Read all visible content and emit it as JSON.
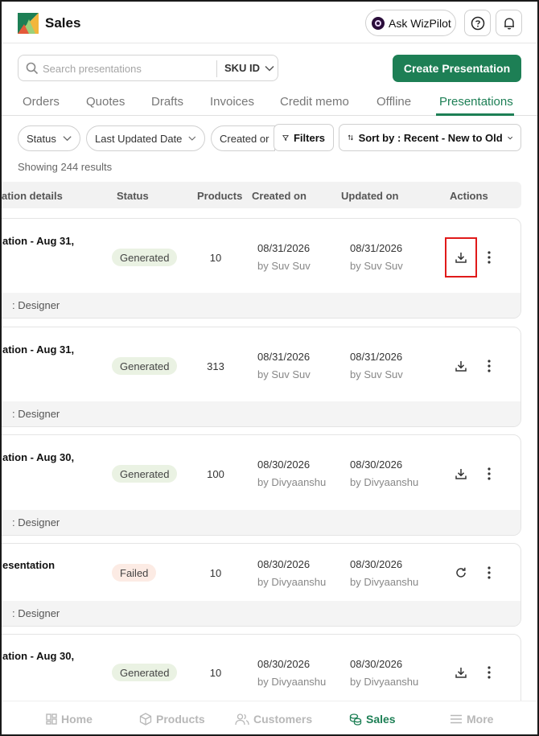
{
  "header": {
    "title": "Sales",
    "ask_label": "Ask WizPilot",
    "help_icon": "help-circle-icon",
    "bell_icon": "bell-icon"
  },
  "search": {
    "placeholder": "Search presentations",
    "sku_label": "SKU ID",
    "create_label": "Create Presentation"
  },
  "tabs": [
    "Orders",
    "Quotes",
    "Drafts",
    "Invoices",
    "Credit memo",
    "Offline",
    "Presentations"
  ],
  "active_tab": "Presentations",
  "filters": {
    "status": "Status",
    "last_updated": "Last Updated Date",
    "created_on": "Created or",
    "filters_label": "Filters",
    "sort_label": "Sort by : Recent - New to Old"
  },
  "results_text": "Showing 244 results",
  "columns": {
    "details": "ation details",
    "status": "Status",
    "products": "Products",
    "created": "Created on",
    "updated": "Updated on",
    "actions": "Actions"
  },
  "rows": [
    {
      "name": "ation - Aug 31,",
      "status": "Generated",
      "products": "10",
      "created": "08/31/2026",
      "created_by": "by Suv Suv",
      "updated": "08/31/2026",
      "updated_by": "by Suv Suv",
      "footer": ": Designer",
      "action": "download"
    },
    {
      "name": "ation - Aug 31,",
      "status": "Generated",
      "products": "313",
      "created": "08/31/2026",
      "created_by": "by Suv Suv",
      "updated": "08/31/2026",
      "updated_by": "by Suv Suv",
      "footer": ": Designer",
      "action": "download"
    },
    {
      "name": "ation - Aug 30,",
      "status": "Generated",
      "products": "100",
      "created": "08/30/2026",
      "created_by": "by Divyaanshu",
      "updated": "08/30/2026",
      "updated_by": "by Divyaanshu",
      "footer": ": Designer",
      "action": "download"
    },
    {
      "name": "esentation",
      "status": "Failed",
      "products": "10",
      "created": "08/30/2026",
      "created_by": "by Divyaanshu",
      "updated": "08/30/2026",
      "updated_by": "by Divyaanshu",
      "footer": ": Designer",
      "action": "retry"
    },
    {
      "name": "ation - Aug 30,",
      "status": "Generated",
      "products": "10",
      "created": "08/30/2026",
      "created_by": "by Divyaanshu",
      "updated": "08/30/2026",
      "updated_by": "by Divyaanshu",
      "footer": "",
      "action": "download"
    }
  ],
  "bottom_nav": [
    "Home",
    "Products",
    "Customers",
    "Sales",
    "More"
  ],
  "colors": {
    "accent": "#1d7f55",
    "highlight": "#e01a1a"
  }
}
